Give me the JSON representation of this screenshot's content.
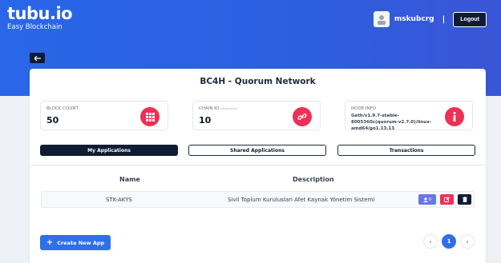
{
  "brand": {
    "name": "tubu.io",
    "tagline": "Easy Blockchain"
  },
  "user": {
    "username": "mskubcrg",
    "separator": "|",
    "logout_label": "Logout"
  },
  "page": {
    "title": "BC4H - Quorum Network"
  },
  "stats": [
    {
      "label": "BLOCK COUNT",
      "value": "50",
      "icon": "grid-icon"
    },
    {
      "label": "CHAIN ID",
      "sublabel": "(CHAIN HASH)",
      "value": "10",
      "icon": "link-icon"
    },
    {
      "label": "NODE INFO",
      "value": "Geth/v1.9.7-stable-8005360c(quorum-v2.7.0)/linux-amd64/go1.13.13",
      "icon": "info-icon"
    }
  ],
  "tabs": [
    {
      "label": "My Applications",
      "active": true
    },
    {
      "label": "Shared Applications",
      "active": false
    },
    {
      "label": "Transactions",
      "active": false
    }
  ],
  "table": {
    "columns": [
      "Name",
      "Description"
    ],
    "rows": [
      {
        "name": "STK-AKYS",
        "description": "Sivil Toplum Kuruluslari Afet Kaynak Yönetim Sistemi",
        "user_count": "0"
      }
    ]
  },
  "actions": {
    "create_label": "Create New App"
  },
  "pagination": {
    "current_page": "1",
    "prev": "‹",
    "next": "›"
  },
  "colors": {
    "accent_red": "#ef2f55",
    "navy": "#0f1c33",
    "primary_blue": "#2f6fe8",
    "header_blue": "#2a66e8"
  }
}
